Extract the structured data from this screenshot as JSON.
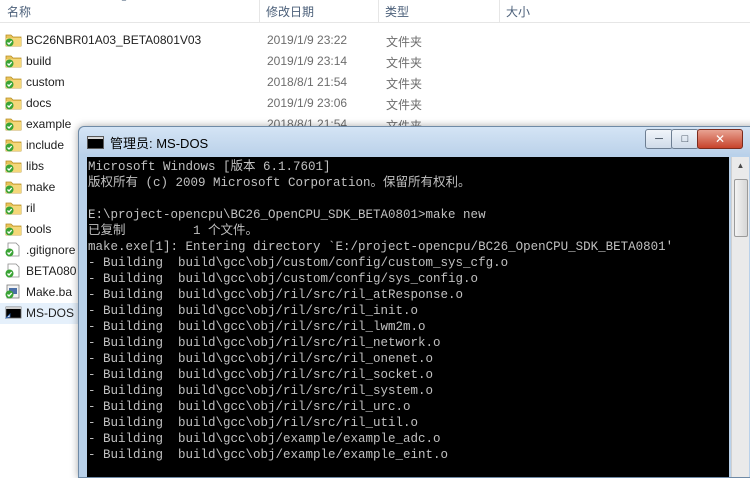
{
  "header": {
    "name": "名称",
    "date": "修改日期",
    "type": "类型",
    "size": "大小"
  },
  "files": [
    {
      "name": "BC26NBR01A03_BETA0801V03",
      "date": "2019/1/9 23:22",
      "type": "文件夹",
      "icon": "folder-icon"
    },
    {
      "name": "build",
      "date": "2019/1/9 23:14",
      "type": "文件夹",
      "icon": "folder-icon"
    },
    {
      "name": "custom",
      "date": "2018/8/1 21:54",
      "type": "文件夹",
      "icon": "folder-icon"
    },
    {
      "name": "docs",
      "date": "2019/1/9 23:06",
      "type": "文件夹",
      "icon": "folder-icon"
    },
    {
      "name": "example",
      "date": "2018/8/1 21:54",
      "type": "文件夹",
      "icon": "folder-icon"
    },
    {
      "name": "include",
      "date": "",
      "type": "",
      "icon": "folder-icon"
    },
    {
      "name": "libs",
      "date": "",
      "type": "",
      "icon": "folder-icon"
    },
    {
      "name": "make",
      "date": "",
      "type": "",
      "icon": "folder-icon"
    },
    {
      "name": "ril",
      "date": "",
      "type": "",
      "icon": "folder-icon"
    },
    {
      "name": "tools",
      "date": "",
      "type": "",
      "icon": "folder-icon"
    },
    {
      "name": ".gitignore",
      "date": "",
      "type": "",
      "icon": "file-icon"
    },
    {
      "name": "BETA080",
      "date": "",
      "type": "",
      "icon": "file-icon"
    },
    {
      "name": "Make.ba",
      "date": "",
      "type": "",
      "icon": "batch-file-icon"
    },
    {
      "name": "MS-DOS",
      "date": "",
      "type": "",
      "icon": "shortcut-icon"
    }
  ],
  "console": {
    "title": "管理员: MS-DOS",
    "minimize": "─",
    "maximize": "□",
    "close": "✕",
    "lines": [
      "Microsoft Windows [版本 6.1.7601]",
      "版权所有 (c) 2009 Microsoft Corporation。保留所有权利。",
      "",
      "E:\\project-opencpu\\BC26_OpenCPU_SDK_BETA0801>make new",
      "已复制         1 个文件。",
      "make.exe[1]: Entering directory `E:/project-opencpu/BC26_OpenCPU_SDK_BETA0801'",
      "- Building  build\\gcc\\obj/custom/config/custom_sys_cfg.o",
      "- Building  build\\gcc\\obj/custom/config/sys_config.o",
      "- Building  build\\gcc\\obj/ril/src/ril_atResponse.o",
      "- Building  build\\gcc\\obj/ril/src/ril_init.o",
      "- Building  build\\gcc\\obj/ril/src/ril_lwm2m.o",
      "- Building  build\\gcc\\obj/ril/src/ril_network.o",
      "- Building  build\\gcc\\obj/ril/src/ril_onenet.o",
      "- Building  build\\gcc\\obj/ril/src/ril_socket.o",
      "- Building  build\\gcc\\obj/ril/src/ril_system.o",
      "- Building  build\\gcc\\obj/ril/src/ril_urc.o",
      "- Building  build\\gcc\\obj/ril/src/ril_util.o",
      "- Building  build\\gcc\\obj/example/example_adc.o",
      "- Building  build\\gcc\\obj/example/example_eint.o"
    ]
  }
}
